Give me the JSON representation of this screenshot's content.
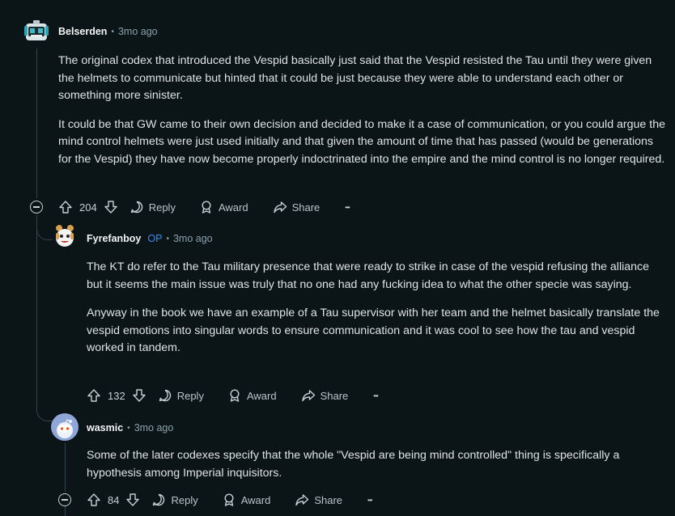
{
  "comments": [
    {
      "author": "Belserden",
      "op_badge": "",
      "time": "3mo ago",
      "paragraphs": [
        "The original codex that introduced the Vespid basically just said that the Vespid resisted the Tau until they were given the helmets to communicate but hinted that it could be just because they were able to understand each other or something more sinister.",
        "It could be that GW came to their own decision and decided to make it a case of communication, or you could argue the mind control helmets were just used initially and that given the amount of time that has passed (would be generations for the Vespid) they have now become properly indoctrinated into the empire and the mind control is no longer required."
      ],
      "votes": "204",
      "reply_label": "Reply",
      "award_label": "Award",
      "share_label": "Share",
      "more_label": "•••"
    },
    {
      "author": "Fyrefanboy",
      "op_badge": "OP",
      "time": "3mo ago",
      "paragraphs": [
        "The KT do refer to the Tau military presence that were ready to strike in case of the vespid refusing the alliance but it seems the main issue was truly that no one had any fucking idea to what the other specie was saying.",
        "Anyway in the book we have an example of a Tau supervisor with her team and the helmet basically translate the vespid emotions into singular words to ensure communication and it was cool to see how the tau and vespid worked in tandem."
      ],
      "votes": "132",
      "reply_label": "Reply",
      "award_label": "Award",
      "share_label": "Share",
      "more_label": "•••"
    },
    {
      "author": "wasmic",
      "op_badge": "",
      "time": "3mo ago",
      "paragraphs": [
        "Some of the later codexes specify that the whole \"Vespid are being mind controlled\" thing is specifically a hypothesis among Imperial inquisitors."
      ],
      "votes": "84",
      "reply_label": "Reply",
      "award_label": "Award",
      "share_label": "Share",
      "more_label": "•••"
    }
  ],
  "colors": {
    "background": "#0b1416",
    "thread_line": "#33464c",
    "op_badge": "#3d8cf0",
    "meta_text": "#8ba2ad"
  },
  "icons": [
    "collapse-icon",
    "upvote-icon",
    "downvote-icon",
    "reply-icon",
    "award-icon",
    "share-icon",
    "more-icon"
  ]
}
